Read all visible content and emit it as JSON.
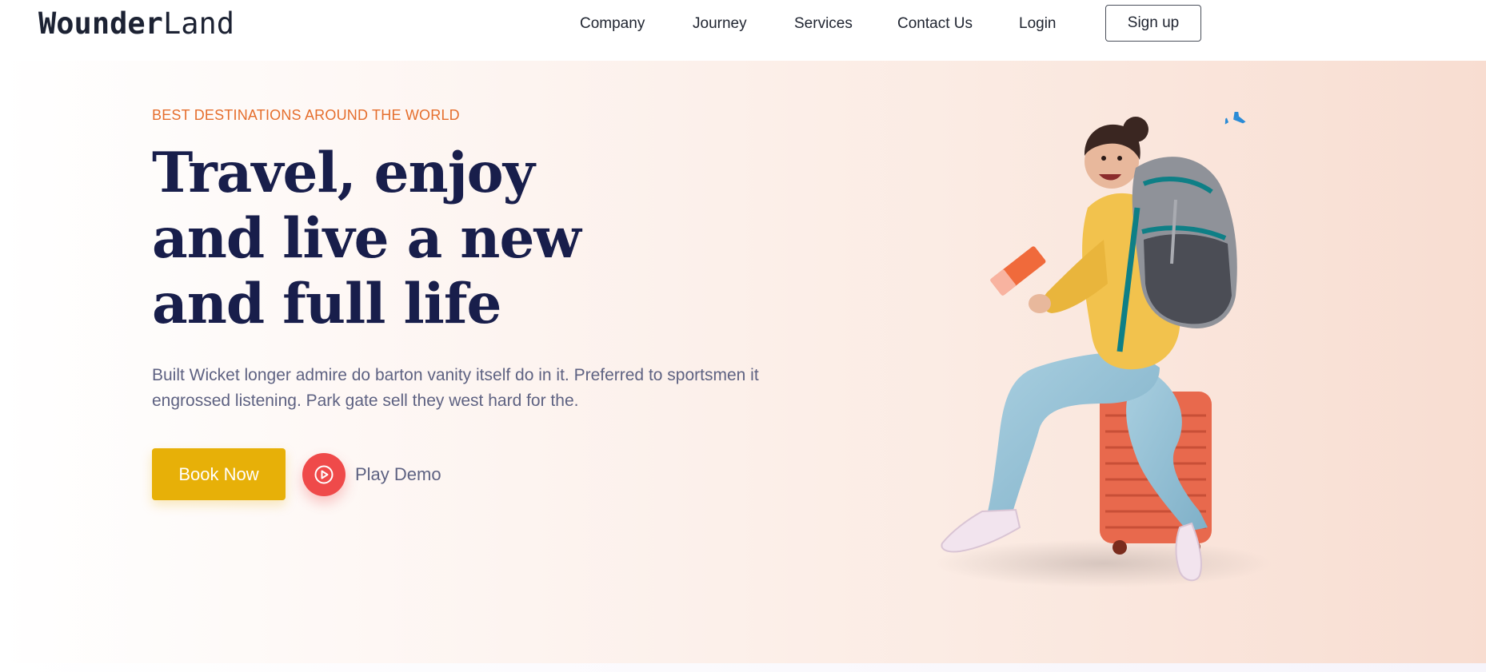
{
  "header": {
    "logo": {
      "part1": "Wounder",
      "part2": "Land"
    },
    "nav": [
      {
        "label": "Company"
      },
      {
        "label": "Journey"
      },
      {
        "label": "Services"
      },
      {
        "label": "Contact Us"
      },
      {
        "label": "Login"
      }
    ],
    "signup_label": "Sign up"
  },
  "hero": {
    "eyebrow": "BEST DESTINATIONS AROUND THE WORLD",
    "headline": [
      "Travel, enjoy",
      "and live a new",
      "and full life"
    ],
    "description": "Built Wicket longer admire do barton vanity itself do in it. Preferred to sportsmen it engrossed listening. Park gate sell they west hard for the.",
    "book_label": "Book Now",
    "play_label": "Play Demo"
  },
  "colors": {
    "accent_orange": "#e56e2d",
    "headline_navy": "#181e4b",
    "book_yellow": "#e7b008",
    "play_red": "#ef4a4a",
    "text_gray": "#5e6282"
  },
  "icons": {
    "play": "play-circle-icon",
    "plane": "airplane-icon"
  }
}
